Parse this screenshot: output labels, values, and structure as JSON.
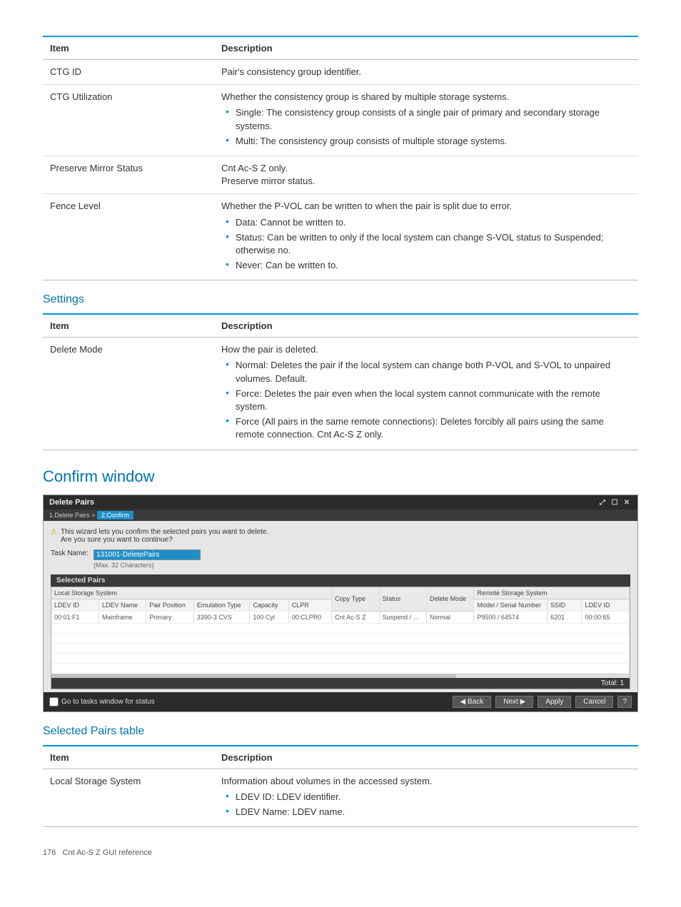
{
  "tables": {
    "t1": {
      "head_item": "Item",
      "head_desc": "Description",
      "rows": [
        {
          "item": "CTG ID",
          "desc_intro": "Pair's consistency group identifier.",
          "bullets": []
        },
        {
          "item": "CTG Utilization",
          "desc_intro": "Whether the consistency group is shared by multiple storage systems.",
          "bullets": [
            "Single: The consistency group consists of a single pair of primary and secondary storage systems.",
            "Multi: The consistency group consists of multiple storage systems."
          ]
        },
        {
          "item": "Preserve Mirror Status",
          "desc_intro": "Cnt Ac-S Z only.",
          "desc_line2": "Preserve mirror status.",
          "bullets": []
        },
        {
          "item": "Fence Level",
          "desc_intro": "Whether the P-VOL can be written to when the pair is split due to error.",
          "bullets": [
            "Data: Cannot be written to.",
            "Status: Can be written to only if the local system can change S-VOL status to Suspended; otherwise no.",
            "Never: Can be written to."
          ]
        }
      ]
    },
    "t2": {
      "head_item": "Item",
      "head_desc": "Description",
      "rows": [
        {
          "item": "Delete Mode",
          "desc_intro": "How the pair is deleted.",
          "bullets": [
            "Normal: Deletes the pair if the local system can change both P-VOL and S-VOL to unpaired volumes. Default.",
            "Force: Deletes the pair even when the local system cannot communicate with the remote system.",
            "Force (All pairs in the same remote connections): Deletes forcibly all pairs using the same remote connection. Cnt Ac-S Z only."
          ]
        }
      ]
    },
    "t3": {
      "head_item": "Item",
      "head_desc": "Description",
      "rows": [
        {
          "item": "Local Storage System",
          "desc_intro": "Information about volumes in the accessed system.",
          "bullets": [
            "LDEV ID: LDEV identifier.",
            "LDEV Name: LDEV name."
          ]
        }
      ]
    }
  },
  "headings": {
    "settings": "Settings",
    "confirm_window": "Confirm window",
    "selected_pairs_table": "Selected Pairs table"
  },
  "dialog": {
    "title": "Delete Pairs",
    "crumb1": "1.Delete Pairs",
    "crumb_sep": ">",
    "crumb2": "2.Confirm",
    "warn_l1": "This wizard lets you confirm the selected pairs you want to delete.",
    "warn_l2": "Are you sure you want to continue?",
    "task_label": "Task Name:",
    "task_value": "131001-DeletePairs",
    "task_hint": "(Max. 32 Characters)",
    "tab_selected": "Selected Pairs",
    "group_local": "Local Storage System",
    "group_remote": "Remote Storage System",
    "cols": {
      "ldev_id": "LDEV ID",
      "ldev_name": "LDEV Name",
      "pair_pos": "Pair Position",
      "emu": "Emulation Type",
      "cap": "Capacity",
      "clpr": "CLPR",
      "copy": "Copy Type",
      "status": "Status",
      "del_mode": "Delete Mode",
      "model": "Model / Serial Number",
      "ssid": "SSID",
      "r_ldev": "LDEV ID"
    },
    "row": {
      "ldev_id": "00:01:F1",
      "ldev_name": "Mainframe",
      "pair_pos": "Primary",
      "emu": "3390-3 CVS",
      "cap": "100 Cyl",
      "clpr": "00:CLPR0",
      "copy": "Cnt Ac-S Z",
      "status": "Suspend / …",
      "del_mode": "Normal",
      "model": "P9500 / 64574",
      "ssid": "6201",
      "r_ldev": "00:00:65"
    },
    "total_label": "Total:",
    "total_value": "1",
    "footer_check": "Go to tasks window for status",
    "btn_back": "◀ Back",
    "btn_next": "Next ▶",
    "btn_apply": "Apply",
    "btn_cancel": "Cancel",
    "btn_help": "?"
  },
  "footer": {
    "page": "176",
    "text": "Cnt Ac-S Z GUI reference"
  }
}
